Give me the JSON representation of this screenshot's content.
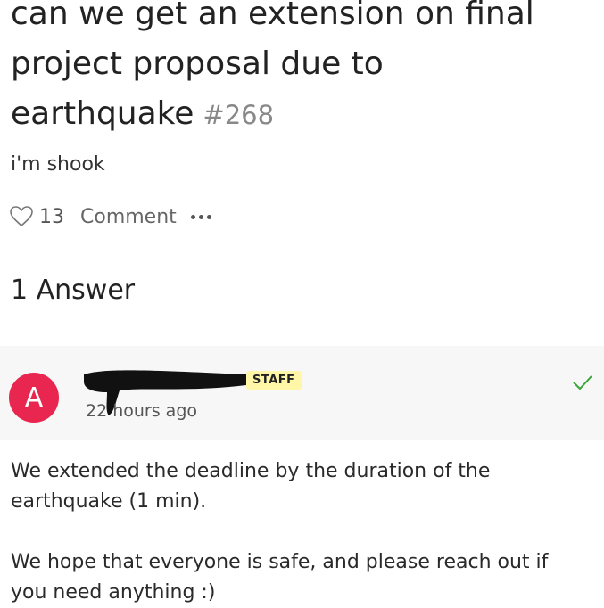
{
  "question": {
    "title": "can we get an extension on final project proposal due to earthquake",
    "number": "#268",
    "body": "i'm shook",
    "like_count": "13",
    "comment_label": "Comment"
  },
  "answers": {
    "heading": "1 Answer",
    "items": [
      {
        "avatar_letter": "A",
        "avatar_color": "#e8264f",
        "badge": "STAFF",
        "timestamp": "22 hours ago",
        "paragraphs": [
          "We extended the deadline by the duration of the earthquake (1 min).",
          "We hope that everyone is safe, and please reach out if you need anything :)"
        ]
      }
    ]
  },
  "icons": {
    "like": "heart-icon",
    "more": "more-icon",
    "accepted": "check-icon"
  },
  "colors": {
    "accent_check": "#3aa53a",
    "staff_badge_bg": "#fff6a8"
  }
}
